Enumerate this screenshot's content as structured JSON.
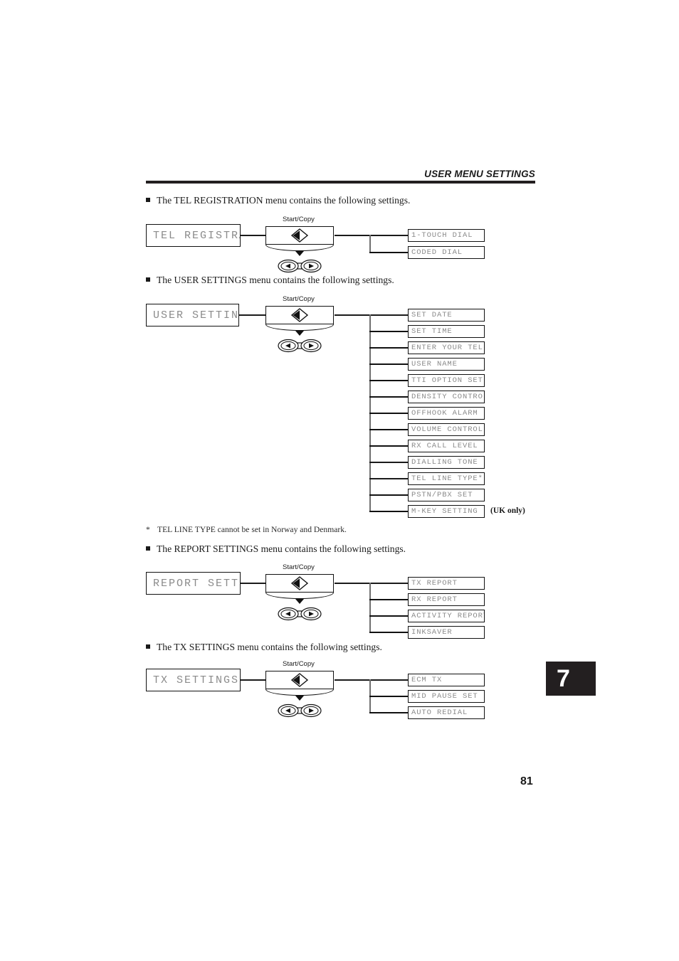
{
  "header": {
    "title": "USER MENU SETTINGS"
  },
  "page_number": "81",
  "chapter_tab": "7",
  "key": {
    "label": "Start/Copy"
  },
  "sections": [
    {
      "id": "tel-registration",
      "intro_prefix": "The ",
      "intro_name": "TEL REGISTRATION",
      "intro_suffix": " menu contains the following settings.",
      "intro_full": "The TEL REGISTRATION menu contains the following settings.",
      "menu_label": "TEL REGISTRATION",
      "items": [
        {
          "label": "1-TOUCH DIAL",
          "note": ""
        },
        {
          "label": "CODED DIAL",
          "note": ""
        }
      ]
    },
    {
      "id": "user-settings",
      "intro_full": "The USER SETTINGS menu contains the following settings.",
      "menu_label": "USER SETTINGS",
      "items": [
        {
          "label": "SET DATE",
          "note": ""
        },
        {
          "label": "SET TIME",
          "note": ""
        },
        {
          "label": "ENTER YOUR TEL",
          "note": ""
        },
        {
          "label": "USER NAME",
          "note": ""
        },
        {
          "label": "TTI OPTION SET",
          "note": ""
        },
        {
          "label": "DENSITY CONTROL",
          "note": ""
        },
        {
          "label": "OFFHOOK ALARM",
          "note": ""
        },
        {
          "label": "VOLUME CONTROL",
          "note": ""
        },
        {
          "label": "RX CALL LEVEL",
          "note": ""
        },
        {
          "label": "DIALLING TONE",
          "note": ""
        },
        {
          "label": "TEL LINE TYPE*",
          "note": ""
        },
        {
          "label": "PSTN/PBX SET",
          "note": ""
        },
        {
          "label": "M-KEY SETTING",
          "note": "(UK only)"
        }
      ]
    },
    {
      "id": "report-settings",
      "intro_full": "The REPORT SETTINGS menu contains the following settings.",
      "menu_label": "REPORT SETTINGS",
      "items": [
        {
          "label": "TX REPORT",
          "note": ""
        },
        {
          "label": "RX REPORT",
          "note": ""
        },
        {
          "label": "ACTIVITY REPORT",
          "note": ""
        },
        {
          "label": "INKSAVER",
          "note": ""
        }
      ]
    },
    {
      "id": "tx-settings",
      "intro_full": "The TX SETTINGS menu contains the following settings.",
      "menu_label": "TX SETTINGS",
      "items": [
        {
          "label": "ECM TX",
          "note": ""
        },
        {
          "label": "MID PAUSE SET",
          "note": ""
        },
        {
          "label": "AUTO REDIAL",
          "note": ""
        }
      ]
    }
  ],
  "footnote": {
    "marker": "*",
    "text": "TEL LINE TYPE cannot be set in Norway and Denmark."
  }
}
